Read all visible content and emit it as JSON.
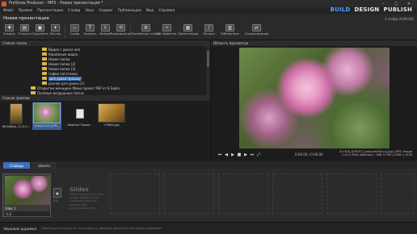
{
  "titlebar": {
    "title": "ProShow Producer - MP3 - Новая презентация *",
    "minimize": "–",
    "maximize": "□",
    "close": "✕"
  },
  "menu": [
    "Файл",
    "Правка",
    "Презентация",
    "Слайд",
    "Звук",
    "Сервис",
    "Публикация",
    "Вид",
    "Справка"
  ],
  "modes": {
    "build": "BUILD",
    "design": "DESIGN",
    "publish": "PUBLISH"
  },
  "project": {
    "name": "Новая презентация",
    "info": "1 слайд (0:06.00)"
  },
  "toolbar": [
    {
      "label": "Создать",
      "icon": "✚"
    },
    {
      "label": "Открыть",
      "icon": "▤"
    },
    {
      "label": "Сохранить",
      "icon": "▣"
    },
    {
      "label": "Мастер",
      "icon": "✦"
    },
    {
      "label": "Слайд",
      "icon": "▭"
    },
    {
      "label": "Надпись",
      "icon": "T"
    },
    {
      "label": "Импорт",
      "icon": "⇩"
    },
    {
      "label": "Периодизация",
      "icon": "⟲"
    },
    {
      "label": "Параметры слайда",
      "icon": "⚙"
    },
    {
      "label": "FX Эффекты",
      "icon": "✧"
    },
    {
      "label": "Презентация",
      "icon": "▦"
    },
    {
      "label": "Музыка",
      "icon": "♪"
    },
    {
      "label": "Библиотека",
      "icon": "▥"
    },
    {
      "label": "Синхронизация",
      "icon": "⇄"
    }
  ],
  "folders": {
    "header": "Список папок",
    "items": [
      "Видео с диска ноя",
      "Корейские видео",
      "Новая папка",
      "Новая папка (2)",
      "Новая папка (3)",
      "гифки заготовки",
      "для урока прошоу",
      "разное для урока (2)",
      "Открытки женщине Маме проект PSP от Е.Sabia",
      "Полевые воздушные песни"
    ]
  },
  "files": {
    "header": "Список файлов",
    "items": [
      {
        "label": "600x60pt_12-0-0..."
      },
      {
        "label": "photo1316_878..."
      },
      {
        "label": "Abstract Flower..."
      },
      {
        "label": "c7f064.jpg"
      }
    ]
  },
  "preview": {
    "header": "Область просмотра",
    "time": "0:00.00 / 0:06.00",
    "file_name": "5r1316_878197_[www.ArtFile.ru].jpg | JPEG Image",
    "file_meta": "1 of 4 (Files Selected) : 388.70 KB | 2048 x 1536"
  },
  "timeline": {
    "tabs": [
      "Слайды",
      "Шкала"
    ],
    "slide1_label": "Slide 1",
    "slide1_duration": "6.0",
    "transition_duration": "3.0",
    "slides_hint_title": "Slides",
    "slides_hint_text": "Перетащите фото или видео файлы сюда. Двойное нажатие мышки для редактирования."
  },
  "audio": {
    "label": "Звуковая дорожка",
    "hint": "Перетащите музыку на эту дорожку. Дважды щёлкните для редактирования"
  }
}
